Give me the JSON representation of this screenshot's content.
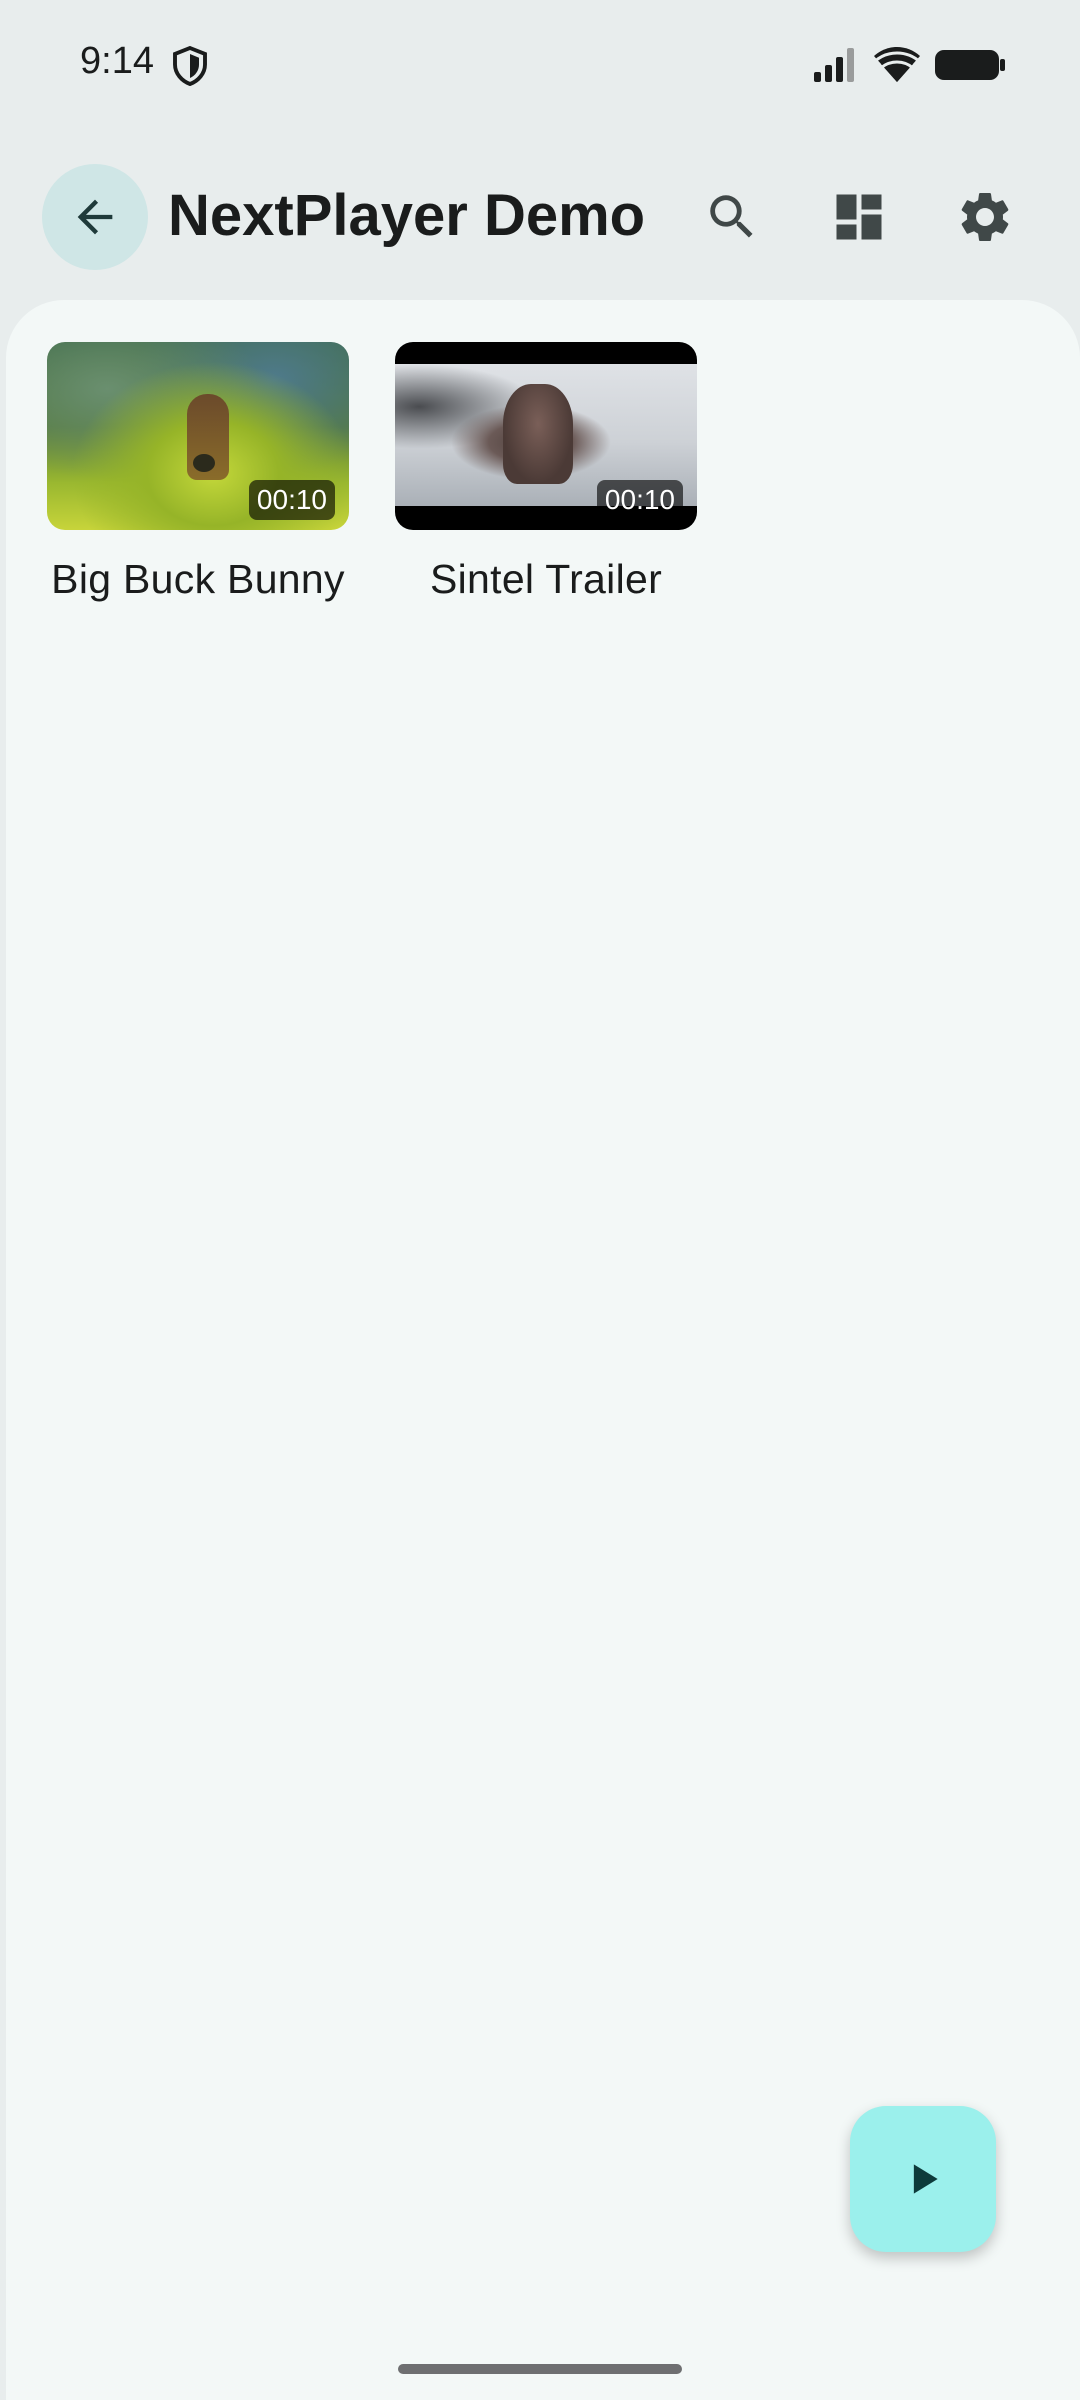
{
  "status_bar": {
    "time": "9:14",
    "icons": [
      "shield-icon",
      "signal-icon",
      "wifi-icon",
      "battery-icon"
    ]
  },
  "app_bar": {
    "title": "NextPlayer Demo",
    "back_icon": "arrow-back-icon",
    "actions": [
      "search-icon",
      "dashboard-layout-icon",
      "settings-gear-icon"
    ]
  },
  "videos": [
    {
      "title": "Big Buck Bunny",
      "duration": "00:10"
    },
    {
      "title": "Sintel Trailer",
      "duration": "00:10"
    }
  ],
  "fab": {
    "icon": "play-icon"
  },
  "colors": {
    "background": "#e8eded",
    "surface": "#f3f8f7",
    "back_button_bg": "#cfe6e6",
    "fab_bg": "#9bf0ec",
    "icon": "#404848"
  }
}
